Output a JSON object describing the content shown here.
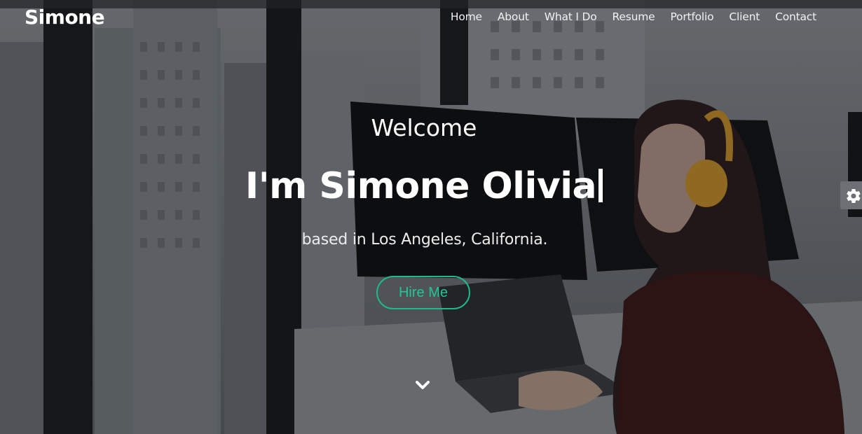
{
  "nav": {
    "brand": "Simone",
    "links": [
      "Home",
      "About",
      "What I Do",
      "Resume",
      "Portfolio",
      "Client",
      "Contact"
    ]
  },
  "hero": {
    "welcome": "Welcome",
    "headline": "I'm Simone Olivia",
    "location": "based in Los Angeles, California.",
    "cta_label": "Hire Me"
  },
  "icons": {
    "scroll": "chevron-down-icon",
    "settings": "gear-icon"
  },
  "colors": {
    "accent": "#20c997",
    "settings_tab": "#6c7075"
  }
}
